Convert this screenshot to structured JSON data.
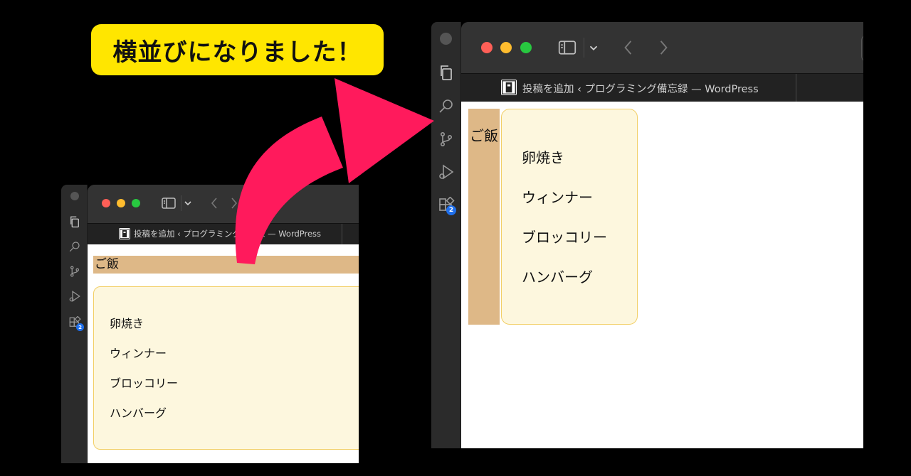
{
  "callout": {
    "text": "横並びになりました！"
  },
  "browser": {
    "tab_title": "投稿を追加 ‹ プログラミング備忘録 — WordPress",
    "sidebar_badge": "2"
  },
  "content": {
    "heading": "ご飯",
    "items": [
      "卵焼き",
      "ウィンナー",
      "ブロッコリー",
      "ハンバーグ"
    ]
  },
  "colors": {
    "heading_bg": "#deb887",
    "list_bg": "#fdf7de",
    "list_border": "#f2cf66",
    "arrow": "#ff1a5c",
    "callout_bg": "#ffe600"
  },
  "icons": [
    "files-icon",
    "search-icon",
    "source-control-icon",
    "run-debug-icon",
    "extensions-icon",
    "sidebar-toggle-icon",
    "chevron-down-icon",
    "back-arrow-icon",
    "forward-arrow-icon",
    "favicon-icon"
  ]
}
